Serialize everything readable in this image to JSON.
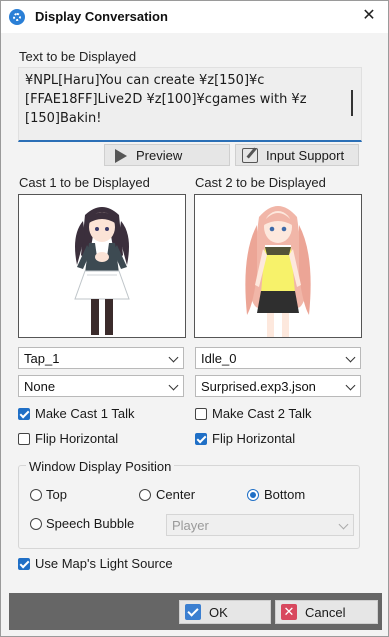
{
  "window": {
    "title": "Display Conversation",
    "close_glyph": "✕",
    "app_icon": "gear-icon"
  },
  "text_section": {
    "label": "Text to be Displayed",
    "lines": [
      "¥NPL[Haru]You can create ¥z[150]¥c",
      "[FFAE18FF]Live2D ¥z[100]¥cgames with ¥z",
      "[150]Bakin!"
    ]
  },
  "buttons": {
    "preview": "Preview",
    "input_support": "Input Support"
  },
  "cast1": {
    "label": "Cast 1 to be Displayed",
    "motion": "Tap_1",
    "expression": "None",
    "talk_label": "Make Cast 1 Talk",
    "talk_checked": true,
    "flip_label": "Flip Horizontal",
    "flip_checked": false
  },
  "cast2": {
    "label": "Cast 2 to be Displayed",
    "motion": "Idle_0",
    "expression": "Surprised.exp3.json",
    "talk_label": "Make Cast 2 Talk",
    "talk_checked": false,
    "flip_label": "Flip Horizontal",
    "flip_checked": true
  },
  "position": {
    "title": "Window Display Position",
    "options": [
      "Top",
      "Center",
      "Bottom",
      "Speech Bubble"
    ],
    "selected": "Bottom",
    "bubble_target": "Player"
  },
  "light_source": {
    "label": "Use Map's Light Source",
    "checked": true
  },
  "footer": {
    "ok": "OK",
    "cancel": "Cancel",
    "cancel_glyph": "✕"
  },
  "colors": {
    "accent": "#1f6fc6",
    "footer_bg": "#666666",
    "cancel_red": "#d8485e"
  }
}
